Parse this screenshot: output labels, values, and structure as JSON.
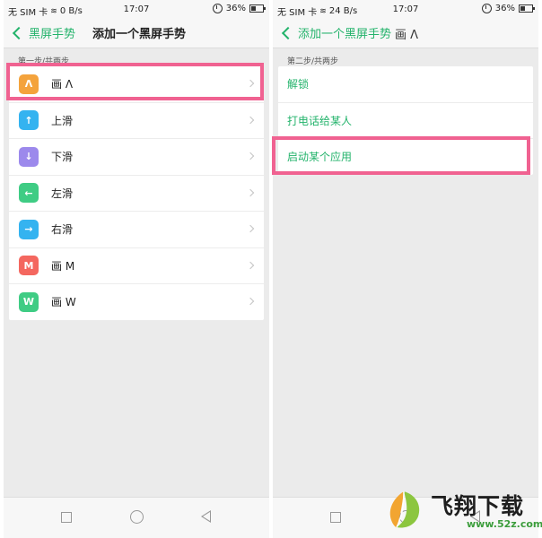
{
  "left": {
    "status": {
      "carrier": "无 SIM 卡",
      "speed": "0 B/s",
      "time": "17:07",
      "battery": "36%"
    },
    "nav": {
      "back_label": "黑屏手势",
      "title": "添加一个黑屏手势"
    },
    "step_label": "第一步/共两步",
    "gestures": [
      {
        "icon": "Λ",
        "label": "画 Λ",
        "color": "#f4a33c"
      },
      {
        "icon": "↑",
        "label": "上滑",
        "color": "#34b3f0"
      },
      {
        "icon": "↓",
        "label": "下滑",
        "color": "#9c89ec"
      },
      {
        "icon": "←",
        "label": "左滑",
        "color": "#3fcc84"
      },
      {
        "icon": "→",
        "label": "右滑",
        "color": "#34b3f0"
      },
      {
        "icon": "M",
        "label": "画 M",
        "color": "#f4675f"
      },
      {
        "icon": "W",
        "label": "画 W",
        "color": "#3fcc84"
      }
    ]
  },
  "right": {
    "status": {
      "carrier": "无 SIM 卡",
      "speed": "24 B/s",
      "time": "17:07",
      "battery": "36%"
    },
    "nav": {
      "back_label": "添加一个黑屏手势",
      "title_suffix": "画 Λ"
    },
    "step_label": "第二步/共两步",
    "actions": [
      "解锁",
      "打电话给某人",
      "启动某个应用"
    ]
  },
  "highlight_color": "#f06291",
  "accent_color": "#23b36b",
  "watermark": {
    "name": "飞翔下载",
    "url": "www.52z.com"
  }
}
